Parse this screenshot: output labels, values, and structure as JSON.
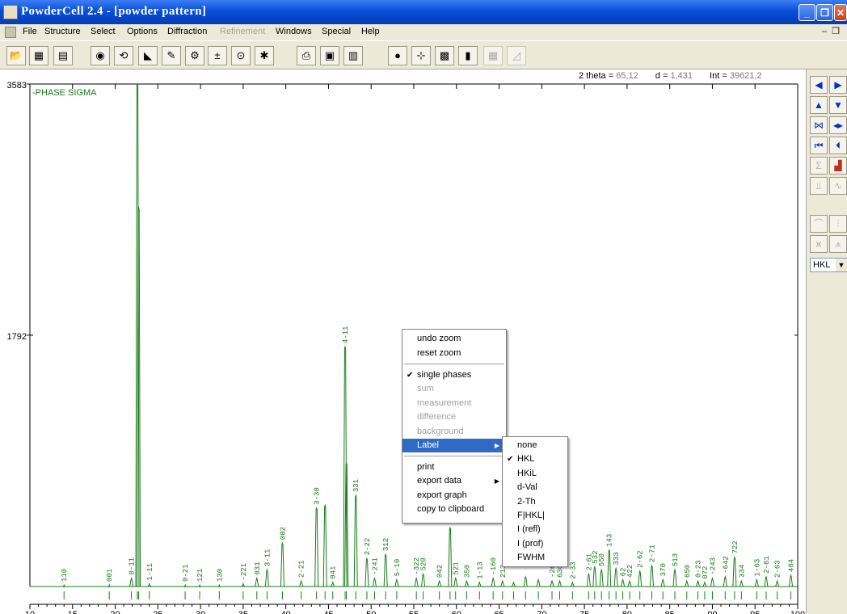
{
  "window": {
    "title": "PowderCell 2.4 - [powder pattern]"
  },
  "menubar": {
    "items": [
      "File",
      "Structure",
      "Select",
      "Options",
      "Diffraction",
      "Refinement",
      "Windows",
      "Special",
      "Help"
    ],
    "disabled": [
      "Refinement"
    ]
  },
  "readout": {
    "two_theta_label": "2 theta =",
    "two_theta": "65,12",
    "d_label": "d =",
    "d": "1,431",
    "int_label": "Int =",
    "int": "39621,2"
  },
  "side_panel": {
    "label_select_value": "HKL"
  },
  "context_menu": {
    "items": [
      "undo zoom",
      "reset zoom",
      "single phases",
      "sum",
      "measurement",
      "difference",
      "background",
      "Label",
      "print",
      "export data",
      "export graph",
      "copy to clipboard"
    ],
    "checked": "single phases",
    "disabled": [
      "sum",
      "measurement",
      "difference",
      "background"
    ],
    "highlighted": "Label"
  },
  "label_submenu": {
    "items": [
      "none",
      "HKL",
      "HKiL",
      "d-Val",
      "2-Th",
      "F|HKL|",
      "I (refl)",
      "I (prof)",
      "FWHM"
    ],
    "checked": "HKL"
  },
  "colors": {
    "pattern": "#1a7a1a",
    "title_bar": "#0a4fd8",
    "highlight": "#316ac5"
  },
  "chart_data": {
    "type": "line",
    "title": "",
    "series": [
      {
        "name": "PHASE SIGMA"
      }
    ],
    "xlim": [
      10,
      100
    ],
    "ylim": [
      0,
      3583
    ],
    "y_ticks": [
      1792,
      3583
    ],
    "x_ticks": [
      10,
      15,
      20,
      25,
      30,
      35,
      40,
      45,
      50,
      55,
      60,
      65,
      70,
      75,
      80,
      85,
      90,
      95,
      100
    ],
    "peaks": [
      {
        "x": 14.0,
        "y": 10,
        "label": "110"
      },
      {
        "x": 19.3,
        "y": 10,
        "label": "001"
      },
      {
        "x": 21.9,
        "y": 60,
        "label": "0-11"
      },
      {
        "x": 22.6,
        "y": 3583
      },
      {
        "x": 22.75,
        "y": 2700
      },
      {
        "x": 24.0,
        "y": 20,
        "label": "1-11"
      },
      {
        "x": 28.2,
        "y": 10,
        "label": "0-21"
      },
      {
        "x": 29.9,
        "y": 10,
        "label": "121"
      },
      {
        "x": 32.2,
        "y": 10,
        "label": "130"
      },
      {
        "x": 35.0,
        "y": 20,
        "label": "-221"
      },
      {
        "x": 36.6,
        "y": 60,
        "label": "031"
      },
      {
        "x": 37.8,
        "y": 120,
        "label": "3-11"
      },
      {
        "x": 39.6,
        "y": 310,
        "label": "002"
      },
      {
        "x": 41.8,
        "y": 40,
        "label": "2-21"
      },
      {
        "x": 43.6,
        "y": 560,
        "label": "3-30"
      },
      {
        "x": 44.6,
        "y": 580
      },
      {
        "x": 45.5,
        "y": 30,
        "label": "041"
      },
      {
        "x": 46.95,
        "y": 1710,
        "label": "4-11"
      },
      {
        "x": 47.1,
        "y": 880
      },
      {
        "x": 48.2,
        "y": 650,
        "label": "331"
      },
      {
        "x": 49.5,
        "y": 200,
        "label": "2-22"
      },
      {
        "x": 50.4,
        "y": 60,
        "label": "-241"
      },
      {
        "x": 51.7,
        "y": 230,
        "label": "312"
      },
      {
        "x": 53.0,
        "y": 50,
        "label": "5-10"
      },
      {
        "x": 55.3,
        "y": 60,
        "label": "-322"
      },
      {
        "x": 56.1,
        "y": 90,
        "label": "520"
      },
      {
        "x": 58.0,
        "y": 40,
        "label": "042"
      },
      {
        "x": 59.25,
        "y": 420
      },
      {
        "x": 59.9,
        "y": 60,
        "label": "521"
      },
      {
        "x": 61.2,
        "y": 40,
        "label": "350"
      },
      {
        "x": 62.7,
        "y": 30,
        "label": "1-13"
      },
      {
        "x": 64.3,
        "y": 60,
        "label": "-160"
      },
      {
        "x": 65.4,
        "y": 40,
        "label": "213"
      },
      {
        "x": 66.7,
        "y": 30
      },
      {
        "x": 68.1,
        "y": 70
      },
      {
        "x": 69.6,
        "y": 50
      },
      {
        "x": 71.2,
        "y": 40,
        "label": "-26"
      },
      {
        "x": 72.1,
        "y": 40,
        "label": "630"
      },
      {
        "x": 73.6,
        "y": 30,
        "label": "2-33"
      },
      {
        "x": 75.5,
        "y": 90,
        "label": "2-61"
      },
      {
        "x": 76.2,
        "y": 140,
        "label": "532"
      },
      {
        "x": 77.0,
        "y": 120,
        "label": "550"
      },
      {
        "x": 77.9,
        "y": 260,
        "label": "143"
      },
      {
        "x": 78.7,
        "y": 130,
        "label": "333"
      },
      {
        "x": 79.5,
        "y": 50,
        "label": "62"
      },
      {
        "x": 80.3,
        "y": 40,
        "label": "422"
      },
      {
        "x": 81.5,
        "y": 110,
        "label": "2-62"
      },
      {
        "x": 82.9,
        "y": 150,
        "label": "2-71"
      },
      {
        "x": 84.2,
        "y": 50,
        "label": "370"
      },
      {
        "x": 85.6,
        "y": 120,
        "label": "513"
      },
      {
        "x": 87.0,
        "y": 40,
        "label": "650"
      },
      {
        "x": 88.3,
        "y": 40,
        "label": "0-23"
      },
      {
        "x": 89.1,
        "y": 30,
        "label": "072"
      },
      {
        "x": 90.0,
        "y": 60,
        "label": "-243"
      },
      {
        "x": 91.5,
        "y": 70,
        "label": "-642"
      },
      {
        "x": 92.6,
        "y": 210,
        "label": "722"
      },
      {
        "x": 93.4,
        "y": 40,
        "label": "334"
      },
      {
        "x": 95.2,
        "y": 50,
        "label": "1-63"
      },
      {
        "x": 96.3,
        "y": 70,
        "label": "2-81"
      },
      {
        "x": 97.6,
        "y": 40,
        "label": "2-63"
      },
      {
        "x": 99.2,
        "y": 80,
        "label": "404"
      }
    ]
  }
}
